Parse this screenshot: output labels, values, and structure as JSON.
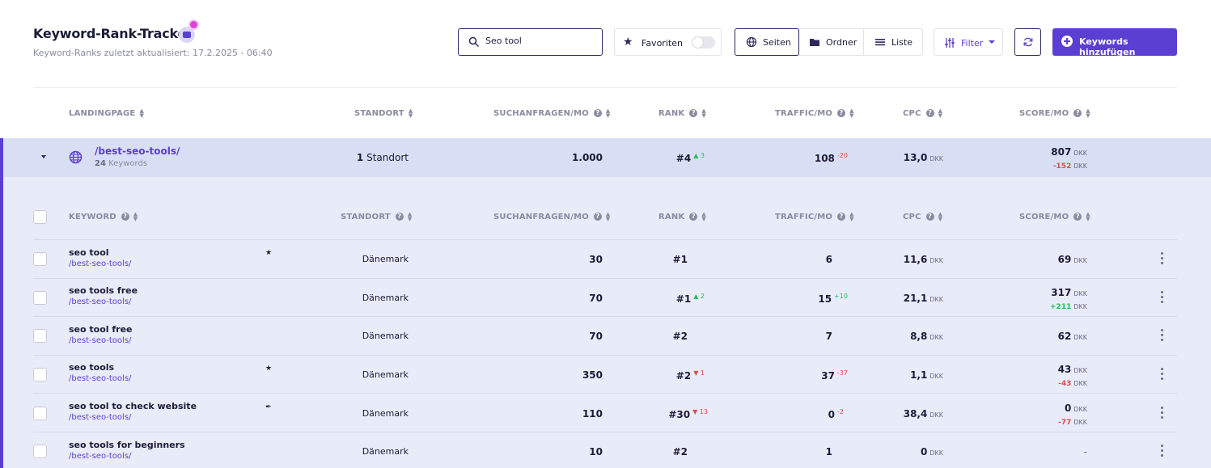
{
  "header": {
    "title": "Keyword-Rank-Tracker",
    "subtitle": "Keyword-Ranks zuletzt aktualisiert: 17.2.2025 - 06:40"
  },
  "toolbar": {
    "search_value": "Seo tool",
    "favorites_label": "Favoriten",
    "favorites_on": false,
    "view_tabs": [
      "Seiten",
      "Ordner",
      "Liste"
    ],
    "active_view": "Seiten",
    "filter_label": "Filter",
    "add_label": "Keywords hinzufügen"
  },
  "colors": {
    "accent": "#5b3fd3",
    "up": "#2cba5e",
    "down": "#e54b4b",
    "group_bg": "#d8dff4",
    "panel_bg": "#e8ebf8"
  },
  "columns": {
    "landingpage": "LANDINGPAGE",
    "keyword": "KEYWORD",
    "standort": "STANDORT",
    "searches": "SUCHANFRAGEN/MO",
    "rank": "RANK",
    "traffic": "TRAFFIC/MO",
    "cpc": "CPC",
    "score": "SCORE/MO"
  },
  "group": {
    "path": "/best-seo-tools/",
    "keyword_count": "24",
    "keyword_word": "Keywords",
    "location_count": "1",
    "location_word": "Standort",
    "searches": "1.000",
    "rank": "#4",
    "rank_change": "3",
    "traffic": "108",
    "traffic_change": "-20",
    "cpc": "13,0",
    "cpc_unit": "DKK",
    "score": "807",
    "score_unit": "DKK",
    "score_change": "-152",
    "score_change_unit": "DKK"
  },
  "rows": [
    {
      "keyword": "seo tool",
      "url": "/best-seo-tools/",
      "icon": "star-icon",
      "location": "Dänemark",
      "searches": "30",
      "rank": "#1",
      "rank_change": "",
      "rank_dir": "",
      "traffic": "6",
      "traffic_change": "",
      "cpc": "11,6",
      "cpc_unit": "DKK",
      "score": "69",
      "score_unit": "DKK",
      "score_change": "",
      "score_dir": ""
    },
    {
      "keyword": "seo tools free",
      "url": "/best-seo-tools/",
      "icon": "",
      "location": "Dänemark",
      "searches": "70",
      "rank": "#1",
      "rank_change": "2",
      "rank_dir": "up",
      "traffic": "15",
      "traffic_change": "+10",
      "cpc": "21,1",
      "cpc_unit": "DKK",
      "score": "317",
      "score_unit": "DKK",
      "score_change": "+211",
      "score_dir": "up"
    },
    {
      "keyword": "seo tool free",
      "url": "/best-seo-tools/",
      "icon": "",
      "location": "Dänemark",
      "searches": "70",
      "rank": "#2",
      "rank_change": "",
      "rank_dir": "",
      "traffic": "7",
      "traffic_change": "",
      "cpc": "8,8",
      "cpc_unit": "DKK",
      "score": "62",
      "score_unit": "DKK",
      "score_change": "",
      "score_dir": ""
    },
    {
      "keyword": "seo tools",
      "url": "/best-seo-tools/",
      "icon": "star-icon",
      "location": "Dänemark",
      "searches": "350",
      "rank": "#2",
      "rank_change": "1",
      "rank_dir": "down",
      "traffic": "37",
      "traffic_change": "-37",
      "cpc": "1,1",
      "cpc_unit": "DKK",
      "score": "43",
      "score_unit": "DKK",
      "score_change": "-43",
      "score_dir": "down"
    },
    {
      "keyword": "seo tool to check website",
      "url": "/best-seo-tools/",
      "icon": "pin-icon",
      "location": "Dänemark",
      "searches": "110",
      "rank": "#30",
      "rank_change": "13",
      "rank_dir": "down",
      "traffic": "0",
      "traffic_change": "-2",
      "cpc": "38,4",
      "cpc_unit": "DKK",
      "score": "0",
      "score_unit": "DKK",
      "score_change": "-77",
      "score_dir": "down"
    },
    {
      "keyword": "seo tools for beginners",
      "url": "/best-seo-tools/",
      "icon": "",
      "location": "Dänemark",
      "searches": "10",
      "rank": "#2",
      "rank_change": "",
      "rank_dir": "",
      "traffic": "1",
      "traffic_change": "",
      "cpc": "0",
      "cpc_unit": "DKK",
      "score": "-",
      "score_unit": "",
      "score_change": "",
      "score_dir": ""
    }
  ]
}
